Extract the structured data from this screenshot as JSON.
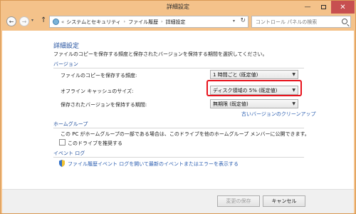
{
  "window": {
    "title": "詳細設定",
    "minimize": "—",
    "close": "✕"
  },
  "nav": {
    "back": "←",
    "forward": "→",
    "history": "▾",
    "up": "↑",
    "address_chevron": "«",
    "breadcrumb": [
      "システムとセキュリティ",
      "ファイル履歴",
      "詳細設定"
    ],
    "breadcrumb_sep": "›",
    "address_dropdown": "▾",
    "refresh": "↻",
    "search_placeholder": "コントロール パネルの検索"
  },
  "main": {
    "title": "詳細設定",
    "description": "ファイルのコピーを保存する頻度と保存されたバージョンを保持する期間を選択してください。",
    "versions": {
      "heading": "バージョン",
      "rows": [
        {
          "label": "ファイルのコピーを保存する頻度:",
          "value": "1 時間ごと (既定値)"
        },
        {
          "label": "オフライン キャッシュのサイズ:",
          "value": "ディスク領域の 5% (既定値)"
        },
        {
          "label": "保存されたバージョンを保持する期間:",
          "value": "無期限 (既定値)"
        }
      ],
      "cleanup_link": "古いバージョンのクリーンアップ"
    },
    "homegroup": {
      "heading": "ホームグループ",
      "description": "この PC がホームグループの一部である場合は、このドライブを他のホームグループ メンバーに公開できます。",
      "checkbox_label": "このドライブを推奨する",
      "checked": false
    },
    "eventlog": {
      "heading": "イベント ログ",
      "link": "ファイル履歴イベント ログを開いて最新のイベントまたはエラーを表示する"
    }
  },
  "footer": {
    "save_label": "変更の保存",
    "cancel_label": "キャンセル"
  },
  "colors": {
    "titlebar": "#f4c28a",
    "close_button": "#c74f50",
    "heading_blue": "#1f4e9d",
    "link_blue": "#2a5db0",
    "highlight_red": "#e8121c"
  }
}
